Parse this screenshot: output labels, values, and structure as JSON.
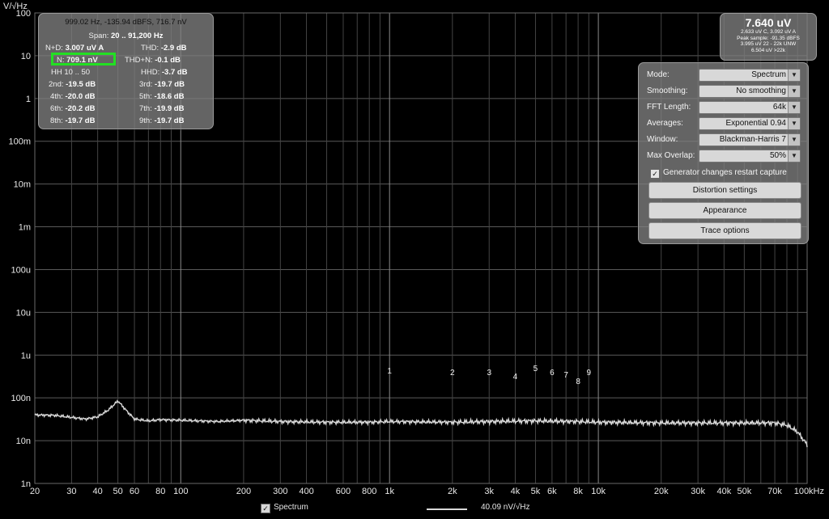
{
  "window": {
    "background": "#000000",
    "trace_color": "#d9d9d9",
    "highlight_color": "#22e022"
  },
  "y_axis": {
    "unit_label": "V/√Hz",
    "ticks": [
      {
        "label": "100",
        "value": 100
      },
      {
        "label": "10",
        "value": 10
      },
      {
        "label": "1",
        "value": 1
      },
      {
        "label": "100m",
        "value": 0.1
      },
      {
        "label": "10m",
        "value": 0.01
      },
      {
        "label": "1m",
        "value": 0.001
      },
      {
        "label": "100u",
        "value": 0.0001
      },
      {
        "label": "10u",
        "value": 1e-05
      },
      {
        "label": "1u",
        "value": 1e-06
      },
      {
        "label": "100n",
        "value": 1e-07
      },
      {
        "label": "10n",
        "value": 1e-08
      },
      {
        "label": "1n",
        "value": 1e-09
      }
    ]
  },
  "x_axis": {
    "ticks": [
      {
        "label": "20",
        "value": 20
      },
      {
        "label": "30",
        "value": 30
      },
      {
        "label": "40",
        "value": 40
      },
      {
        "label": "50",
        "value": 50
      },
      {
        "label": "60",
        "value": 60
      },
      {
        "label": "80",
        "value": 80
      },
      {
        "label": "100",
        "value": 100
      },
      {
        "label": "200",
        "value": 200
      },
      {
        "label": "300",
        "value": 300
      },
      {
        "label": "400",
        "value": 400
      },
      {
        "label": "600",
        "value": 600
      },
      {
        "label": "800",
        "value": 800
      },
      {
        "label": "1k",
        "value": 1000
      },
      {
        "label": "2k",
        "value": 2000
      },
      {
        "label": "3k",
        "value": 3000
      },
      {
        "label": "4k",
        "value": 4000
      },
      {
        "label": "5k",
        "value": 5000
      },
      {
        "label": "6k",
        "value": 6000
      },
      {
        "label": "8k",
        "value": 8000
      },
      {
        "label": "10k",
        "value": 10000
      },
      {
        "label": "20k",
        "value": 20000
      },
      {
        "label": "30k",
        "value": 30000
      },
      {
        "label": "40k",
        "value": 40000
      },
      {
        "label": "50k",
        "value": 50000
      },
      {
        "label": "70k",
        "value": 70000
      },
      {
        "label": "100kHz",
        "value": 100000
      }
    ]
  },
  "chart_data": {
    "type": "line",
    "xscale": "log",
    "yscale": "log",
    "xlim": [
      20,
      100000
    ],
    "ylim": [
      1e-09,
      100
    ],
    "ylabel": "V/√Hz",
    "series": [
      {
        "name": "Spectrum",
        "x": [
          20,
          25,
          30,
          35,
          40,
          45,
          50,
          55,
          60,
          70,
          80,
          100,
          150,
          200,
          300,
          500,
          800,
          1000,
          2000,
          3000,
          5000,
          8000,
          10000,
          20000,
          30000,
          50000,
          60000,
          70000,
          80000,
          90000,
          100000
        ],
        "y": [
          4e-08,
          3.9e-08,
          3.5e-08,
          3.2e-08,
          3.6e-08,
          5.2e-08,
          8.5e-08,
          5e-08,
          3.2e-08,
          2.9e-08,
          3.1e-08,
          3e-08,
          2.8e-08,
          3e-08,
          2.8e-08,
          2.7e-08,
          2.7e-08,
          2.8e-08,
          2.7e-08,
          2.8e-08,
          2.9e-08,
          2.8e-08,
          2.7e-08,
          2.6e-08,
          2.6e-08,
          2.6e-08,
          2.6e-08,
          2.6e-08,
          2.3e-08,
          1.6e-08,
          8e-09
        ]
      }
    ],
    "harmonics": [
      {
        "label": "1",
        "x": 1000
      },
      {
        "label": "2",
        "x": 2000
      },
      {
        "label": "3",
        "x": 3000
      },
      {
        "label": "4",
        "x": 4000
      },
      {
        "label": "5",
        "x": 5000
      },
      {
        "label": "6",
        "x": 6000
      },
      {
        "label": "7",
        "x": 7000
      },
      {
        "label": "8",
        "x": 8000
      },
      {
        "label": "9",
        "x": 9000
      }
    ]
  },
  "readout": {
    "header": "999.02 Hz, -135.94 dBFS, 716.7 nV",
    "span_label": "Span:",
    "span_value": "20 .. 91,200 Hz",
    "nd_label": "N+D:",
    "nd_value": "3.007 uV A",
    "thd_label": "THD:",
    "thd_value": "-2.9 dB",
    "n_label": "N:",
    "n_value": "709.1 nV",
    "thdn_label": "THD+N:",
    "thdn_value": "-0.1 dB",
    "hh_label": "HH 10 .. 50",
    "hhd_label": "HHD:",
    "hhd_value": "-3.7 dB",
    "h2_label": "2nd:",
    "h2_value": "-19.5 dB",
    "h3_label": "3rd:",
    "h3_value": "-19.7 dB",
    "h4_label": "4th:",
    "h4_value": "-20.0 dB",
    "h5_label": "5th:",
    "h5_value": "-18.6 dB",
    "h6_label": "6th:",
    "h6_value": "-20.2 dB",
    "h7_label": "7th:",
    "h7_value": "-19.9 dB",
    "h8_label": "8th:",
    "h8_value": "-19.7 dB",
    "h9_label": "9th:",
    "h9_value": "-19.7 dB"
  },
  "level": {
    "main": "7.640 uV",
    "line1": "2.633 uV C, 3.092 uV A",
    "line2": "Peak sample: -91.35 dBFS",
    "line3": "3.995 uV 22 - 22k UNW",
    "line4": "6.504 uV >22k"
  },
  "settings": {
    "mode_label": "Mode:",
    "mode_value": "Spectrum",
    "smoothing_label": "Smoothing:",
    "smoothing_value": "No  smoothing",
    "fft_label": "FFT Length:",
    "fft_value": "64k",
    "averages_label": "Averages:",
    "averages_value": "Exponential 0.94",
    "window_label": "Window:",
    "window_value": "Blackman-Harris 7",
    "overlap_label": "Max Overlap:",
    "overlap_value": "50%",
    "generator_label": "Generator changes restart capture",
    "distortion_button": "Distortion settings",
    "appearance_button": "Appearance",
    "trace_button": "Trace options"
  },
  "footer": {
    "spectrum_check_label": "Spectrum",
    "legend_value": "40.09 nV/√Hz"
  }
}
